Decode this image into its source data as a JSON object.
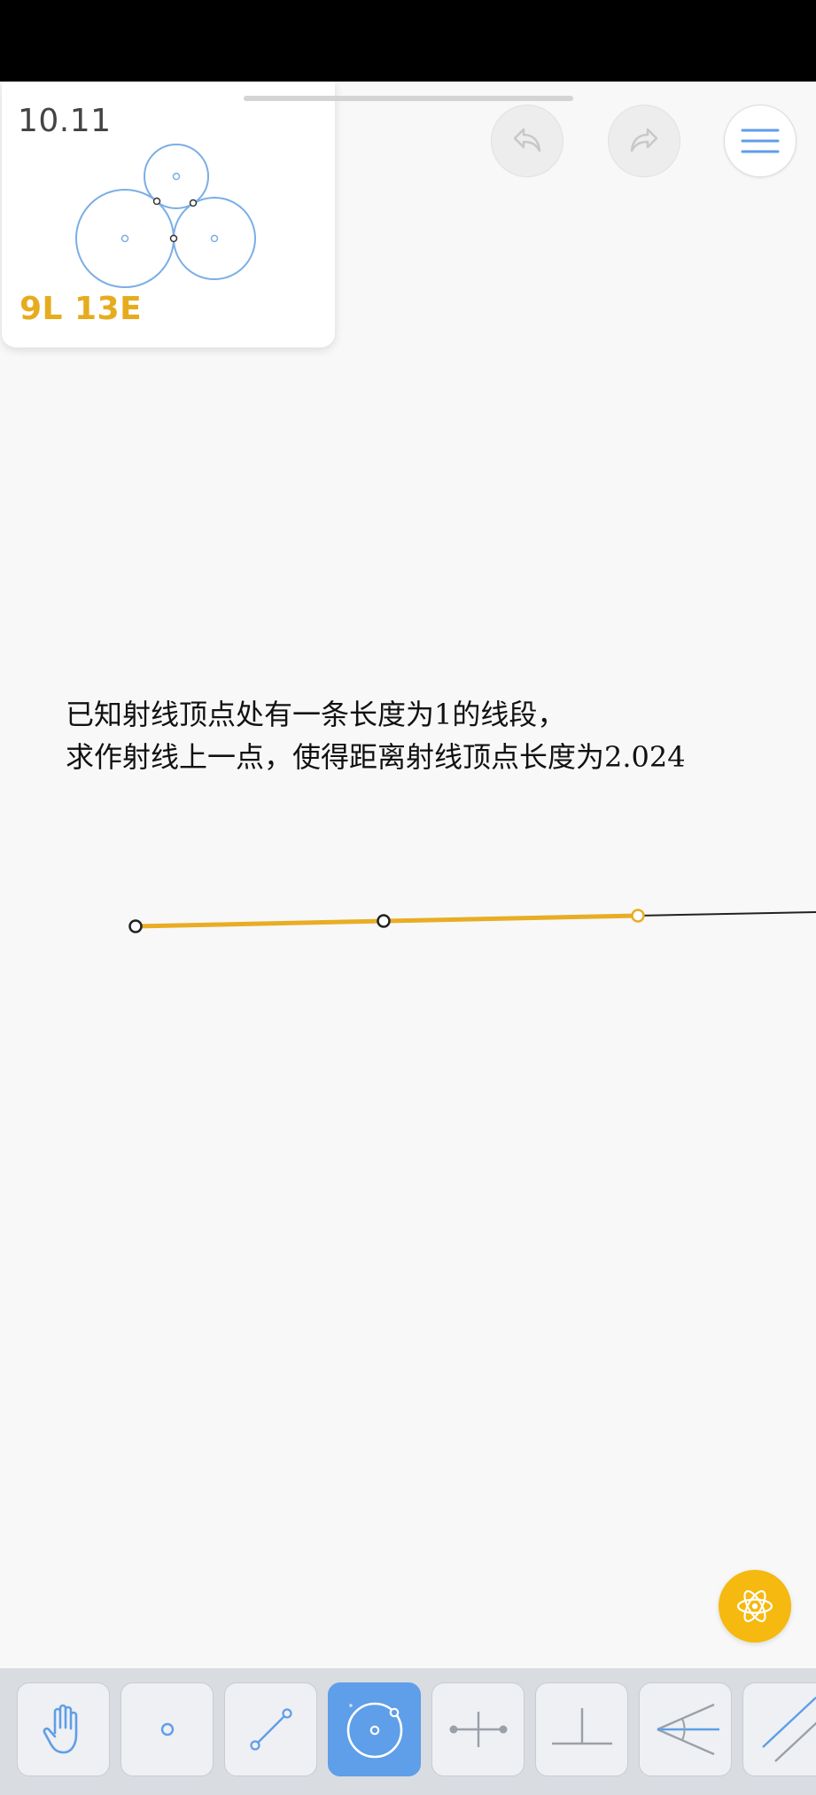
{
  "level": {
    "number": "10.11",
    "score": "9L 13E"
  },
  "header": {
    "undo_icon": "undo-arrow-icon",
    "redo_icon": "redo-arrow-icon",
    "menu_icon": "hamburger-menu-icon"
  },
  "instruction": {
    "line1": "已知射线顶点处有一条长度为1的线段，",
    "line2": "求作射线上一点，使得距离射线顶点长度为2.024"
  },
  "hint_icon": "atom-icon",
  "toolbar": {
    "tools": [
      {
        "name": "move",
        "icon": "hand-icon",
        "active": false
      },
      {
        "name": "point",
        "icon": "point-icon",
        "active": false
      },
      {
        "name": "line",
        "icon": "line-icon",
        "active": false
      },
      {
        "name": "circle",
        "icon": "circle-icon",
        "active": true
      },
      {
        "name": "perpendicular-bisector",
        "icon": "perpendicular-bisector-icon",
        "active": false
      },
      {
        "name": "perpendicular",
        "icon": "perpendicular-icon",
        "active": false
      },
      {
        "name": "angle-bisector",
        "icon": "angle-bisector-icon",
        "active": false
      },
      {
        "name": "parallel",
        "icon": "parallel-icon",
        "active": false
      }
    ]
  },
  "colors": {
    "accent_yellow": "#e6ac1e",
    "accent_blue": "#5f9ee8",
    "preview_blue": "#7aaee6",
    "background": "#f8f8f8",
    "toolbar_bg": "#d9dce1"
  }
}
